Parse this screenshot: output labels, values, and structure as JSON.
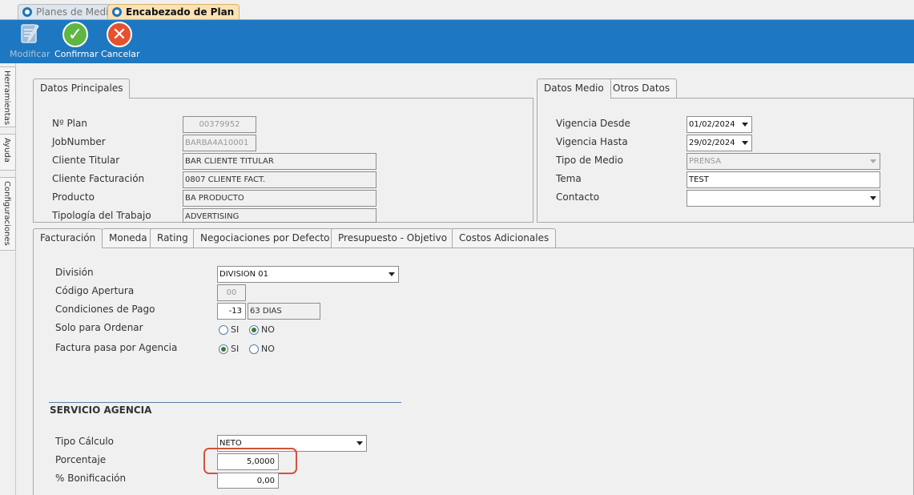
{
  "doc_tabs": [
    {
      "label": "Planes de Medios"
    },
    {
      "label": "Encabezado de Plan"
    }
  ],
  "toolbar": {
    "modify": "Modificar",
    "confirm": "Confirmar",
    "cancel": "Cancelar"
  },
  "sidebar": {
    "tools": "Herramientas",
    "help": "Ayuda",
    "settings": "Configuraciones"
  },
  "principal": {
    "tab": "Datos Principales",
    "plan_label": "Nº Plan",
    "plan_value": "00379952",
    "job_label": "JobNumber",
    "job_value": "BARBA4A10001",
    "client_label": "Cliente Titular",
    "client_value": "BAR CLIENTE TITULAR",
    "billing_label": "Cliente Facturación",
    "billing_value": "0807 CLIENTE FACT.",
    "product_label": "Producto",
    "product_value": "BA PRODUCTO",
    "type_label": "Tipología del Trabajo",
    "type_value": "ADVERTISING"
  },
  "medio": {
    "tab_datos": "Datos Medio",
    "tab_otros": "Otros Datos",
    "from_label": "Vigencia Desde",
    "from_value": "01/02/2024",
    "to_label": "Vigencia Hasta",
    "to_value": "29/02/2024",
    "media_label": "Tipo de Medio",
    "media_value": "PRENSA",
    "theme_label": "Tema",
    "theme_value": "TEST",
    "contact_label": "Contacto",
    "contact_value": ""
  },
  "bottom_tabs": [
    {
      "label": "Facturación"
    },
    {
      "label": "Moneda"
    },
    {
      "label": "Rating"
    },
    {
      "label": "Negociaciones por Defecto"
    },
    {
      "label": "Presupuesto - Objetivo"
    },
    {
      "label": "Costos Adicionales"
    }
  ],
  "billing": {
    "division_label": "División",
    "division_value": "DIVISION 01",
    "opening_label": "Código Apertura",
    "opening_value": "00",
    "payment_label": "Condiciones de Pago",
    "payment_code": "-13",
    "payment_desc": "63 DIAS",
    "order_only_label": "Solo para Ordenar",
    "agency_label": "Factura pasa por Agencia",
    "yes": "SI",
    "no": "NO",
    "order_only_selected": "NO",
    "agency_selected": "SI"
  },
  "service": {
    "title": "SERVICIO AGENCIA",
    "calc_label": "Tipo Cálculo",
    "calc_value": "NETO",
    "percent_label": "Porcentaje",
    "percent_value": "5,0000",
    "bonus_label": "% Bonificación",
    "bonus_value": "0,00"
  },
  "colors": {
    "toolbar": "#1e78c1",
    "active_tab": "#fbe2b5",
    "highlight": "#d5503a"
  }
}
